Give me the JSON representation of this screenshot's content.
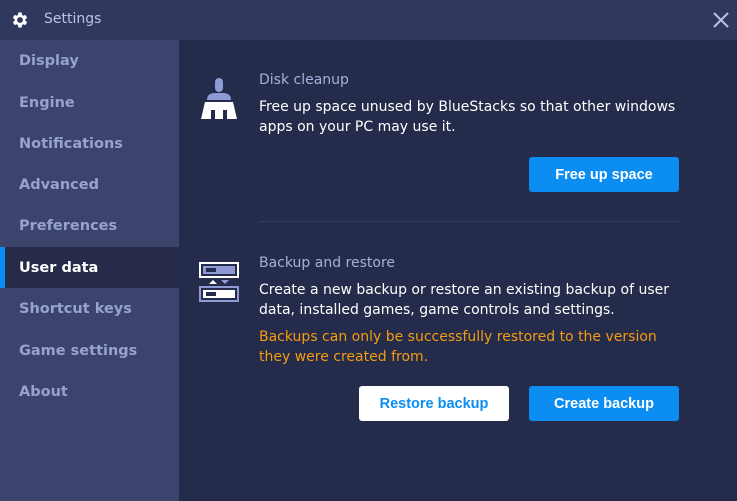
{
  "window": {
    "title": "Settings",
    "icon": "gear-icon",
    "close_icon": "close-icon"
  },
  "sidebar": {
    "items": [
      {
        "label": "Display",
        "active": false
      },
      {
        "label": "Engine",
        "active": false
      },
      {
        "label": "Notifications",
        "active": false
      },
      {
        "label": "Advanced",
        "active": false
      },
      {
        "label": "Preferences",
        "active": false
      },
      {
        "label": "User data",
        "active": true
      },
      {
        "label": "Shortcut keys",
        "active": false
      },
      {
        "label": "Game settings",
        "active": false
      },
      {
        "label": "About",
        "active": false
      }
    ]
  },
  "disk_cleanup": {
    "icon": "broom-icon",
    "title": "Disk cleanup",
    "description": "Free up space unused by BlueStacks so that other windows apps on your PC may use it.",
    "button_label": "Free up space"
  },
  "backup_restore": {
    "icon": "backup-restore-icon",
    "title": "Backup and restore",
    "description": "Create a new backup or restore an existing backup of user data, installed games, game controls and settings.",
    "warning": "Backups can only be successfully restored to the version they were created from.",
    "restore_button_label": "Restore backup",
    "create_button_label": "Create backup"
  },
  "colors": {
    "accent": "#0b8df2",
    "warning": "#f39c12",
    "sidebar_bg": "#3c436d",
    "content_bg": "#252b4a",
    "titlebar_bg": "#313860"
  }
}
